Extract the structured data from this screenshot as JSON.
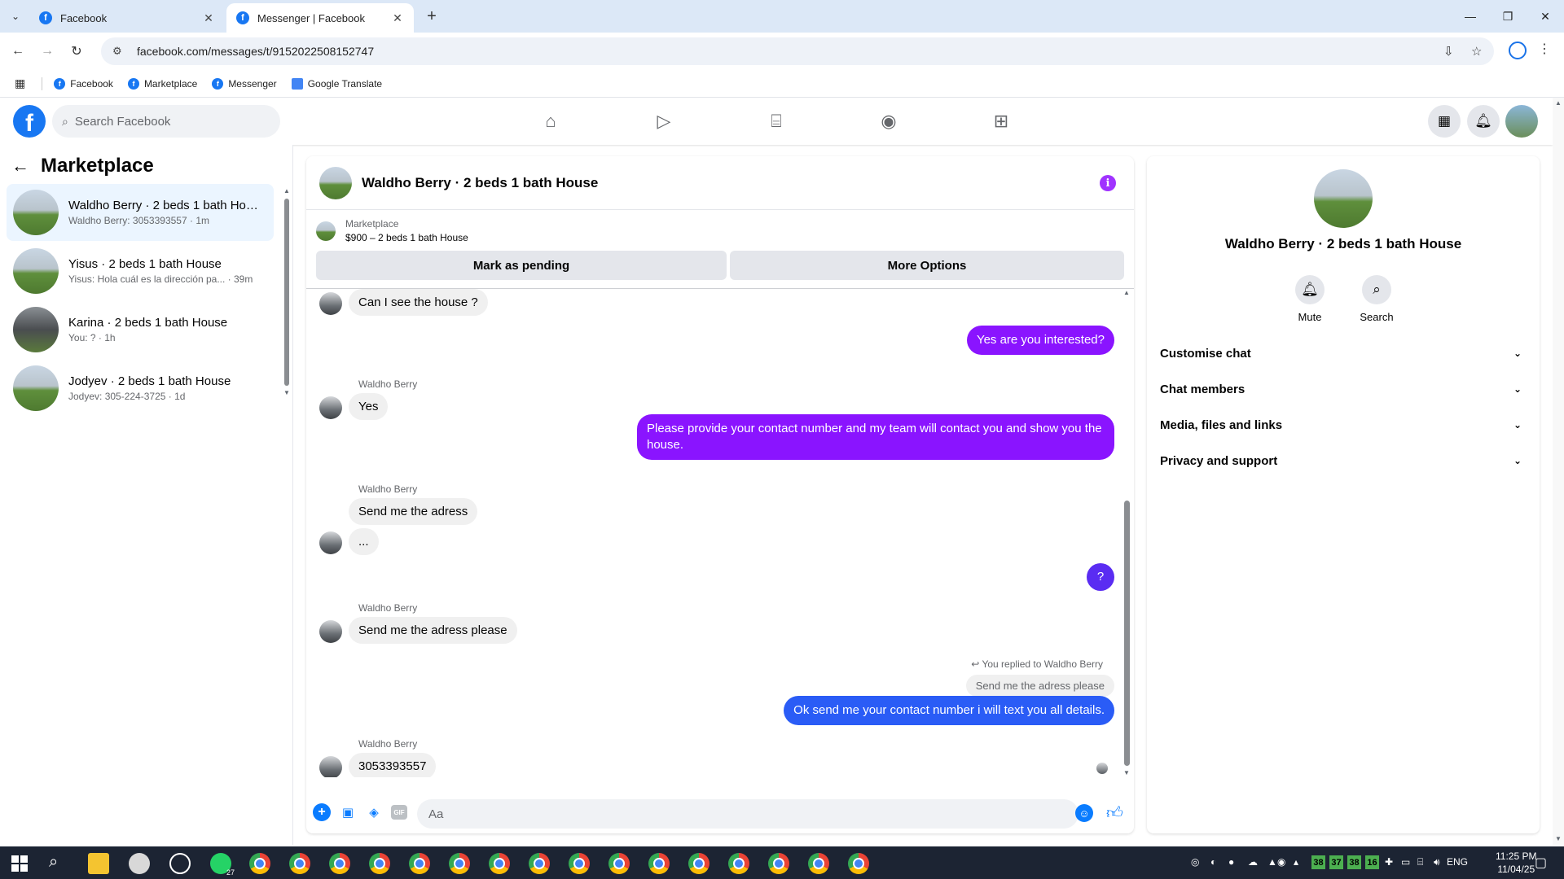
{
  "browser": {
    "tabs": [
      {
        "title": "Facebook",
        "active": false
      },
      {
        "title": "Messenger | Facebook",
        "active": true
      }
    ],
    "url": "facebook.com/messages/t/9152022508152747",
    "bookmarks": [
      "Facebook",
      "Marketplace",
      "Messenger",
      "Google Translate"
    ]
  },
  "fb_header": {
    "logo": "f",
    "search_placeholder": "Search Facebook",
    "nav_icons": [
      "home-icon",
      "watch-icon",
      "marketplace-icon",
      "groups-icon",
      "gaming-icon"
    ]
  },
  "sidebar": {
    "title": "Marketplace",
    "conversations": [
      {
        "name": "Waldho Berry · 2 beds 1 bath House",
        "preview": "Waldho Berry: 3053393557 · 1m",
        "selected": true
      },
      {
        "name": "Yisus · 2 beds 1 bath House",
        "preview": "Yisus: Hola cuál es la dirección pa... · 39m",
        "selected": false
      },
      {
        "name": "Karina · 2 beds 1 bath House",
        "preview": "You: ? · 1h",
        "selected": false
      },
      {
        "name": "Jodyev · 2 beds 1 bath House",
        "preview": "Jodyev: 305-224-3725 · 1d",
        "selected": false
      }
    ]
  },
  "chat": {
    "title": "Waldho Berry · 2 beds 1 bath House",
    "listing_source": "Marketplace",
    "listing_title": "$900 – 2 beds 1 bath House",
    "buttons": {
      "pending": "Mark as pending",
      "more": "More Options"
    },
    "messages": [
      {
        "dir": "in",
        "text": "Can I see the house ?"
      },
      {
        "dir": "out",
        "text": "Yes are you interested?"
      },
      {
        "dir": "in",
        "sender": "Waldho Berry",
        "text": "Yes"
      },
      {
        "dir": "out",
        "text": "Please provide your contact number and my team will contact you and show you the house."
      },
      {
        "dir": "in",
        "sender": "Waldho Berry",
        "text": "Send me the adress"
      },
      {
        "dir": "in",
        "text": "..."
      },
      {
        "dir": "out",
        "text": "?"
      },
      {
        "dir": "in",
        "sender": "Waldho Berry",
        "text": "Send me the adress please"
      },
      {
        "dir": "out",
        "reply_meta": "You replied to Waldho Berry",
        "quoted": "Send me the adress please",
        "text": "Ok send me your contact number i will text you all details."
      },
      {
        "dir": "in",
        "sender": "Waldho Berry",
        "text": "3053393557"
      }
    ],
    "composer_placeholder": "Aa"
  },
  "info_panel": {
    "name": "Waldho Berry · 2 beds 1 bath House",
    "actions": [
      {
        "label": "Mute",
        "icon": "bell-icon"
      },
      {
        "label": "Search",
        "icon": "search-icon"
      }
    ],
    "sections": [
      "Customise chat",
      "Chat members",
      "Media, files and links",
      "Privacy and support"
    ]
  },
  "taskbar": {
    "whatsapp_badge": "27",
    "tray_numbers": [
      "38",
      "37",
      "38",
      "16"
    ],
    "language": "ENG",
    "time": "11:25 PM",
    "date": "11/04/25"
  },
  "colors": {
    "fb_blue": "#1877f2",
    "outgoing_purple": "#8a14ff",
    "outgoing_blue": "#2a5cf6",
    "incoming_gray": "#f0f0f0",
    "selected_row": "#ebf5ff"
  }
}
